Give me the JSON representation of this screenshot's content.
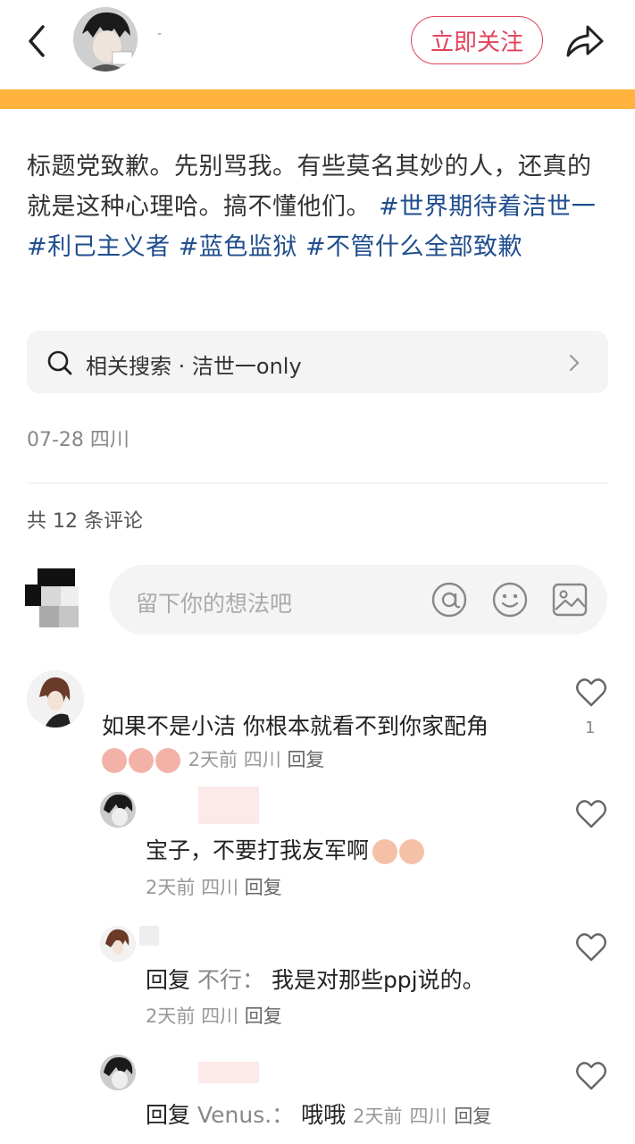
{
  "header": {
    "follow_label": "立即关注",
    "author_name": "-"
  },
  "progress": {
    "fraction": 1.0,
    "color": "#ffb33e"
  },
  "post": {
    "body": "标题党致歉。先别骂我。有些莫名其妙的人，还真的就是这种心理哈。搞不懂他们。",
    "tags": [
      "#世界期待着洁世一",
      "#利己主义者",
      "#蓝色监狱",
      "#不管什么全部致歉"
    ],
    "related_search": "相关搜索 · 洁世一only",
    "date_location": "07-28 四川"
  },
  "comments_header": {
    "count_label": "共 12 条评论",
    "placeholder": "留下你的想法吧"
  },
  "comments": [
    {
      "text": "如果不是小洁 你根本就看不到你家配角",
      "time": "2天前",
      "location": "四川",
      "reply_label": "回复",
      "likes": "1"
    },
    {
      "text": "宝子，不要打我友军啊",
      "time": "2天前",
      "location": "四川",
      "reply_label": "回复"
    },
    {
      "reply_prefix": "回复",
      "reply_to": "不行：",
      "text": "我是对那些ppj说的。",
      "time": "2天前",
      "location": "四川",
      "reply_label": "回复"
    },
    {
      "reply_prefix": "回复",
      "reply_to": "Venus.：",
      "text": "哦哦",
      "time": "2天前",
      "location": "四川",
      "reply_label": "回复"
    }
  ],
  "colors": {
    "accent": "#e0445b",
    "tag": "#1f4d8d",
    "bar": "#ffb33e"
  }
}
